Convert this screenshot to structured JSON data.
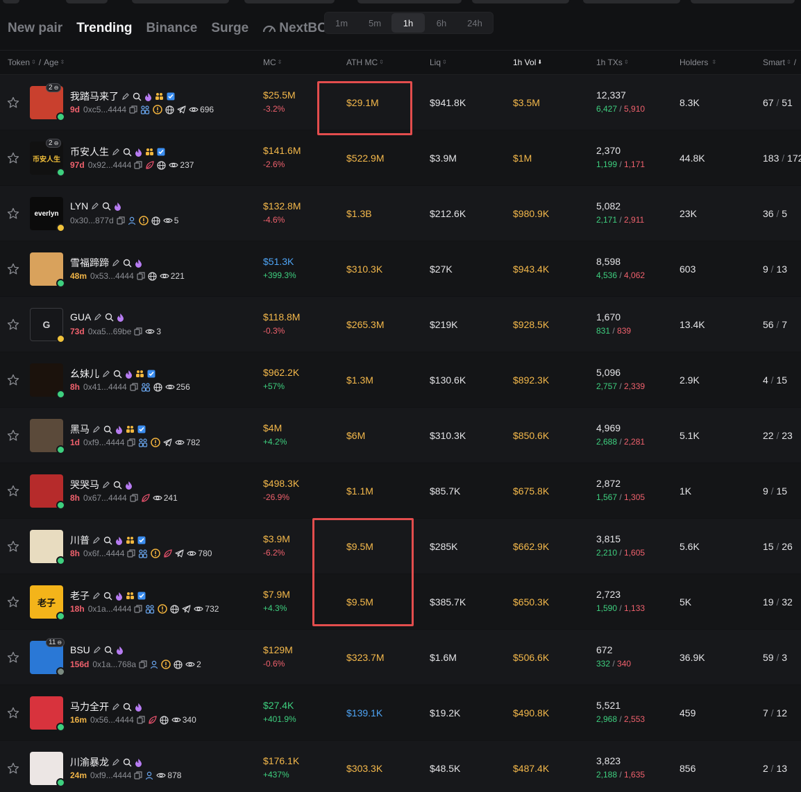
{
  "tabs": [
    {
      "label": "New pair",
      "active": false
    },
    {
      "label": "Trending",
      "active": true
    },
    {
      "label": "Binance",
      "active": false
    },
    {
      "label": "Surge",
      "active": false
    },
    {
      "label": "NextBC",
      "active": false,
      "icon": "gauge-icon"
    }
  ],
  "timeframes": [
    {
      "label": "1m",
      "active": false
    },
    {
      "label": "5m",
      "active": false
    },
    {
      "label": "1h",
      "active": true
    },
    {
      "label": "6h",
      "active": false
    },
    {
      "label": "24h",
      "active": false
    }
  ],
  "columns": {
    "token": "Token",
    "separator": "/",
    "age": "Age",
    "mc": "MC",
    "ath_mc": "ATH MC",
    "liq": "Liq",
    "vol": "1h Vol",
    "txs": "1h TXs",
    "holders": "Holders",
    "smart": "Smart",
    "smart_sep": "/"
  },
  "colors": {
    "background": "#111214",
    "row": "#17181b",
    "gold": "#f5b94b",
    "blue": "#4ea4f5",
    "green": "#3ed07f",
    "red": "#f0616d",
    "highlight": "#e34d4d"
  },
  "rows": [
    {
      "name": "我踏马来了",
      "age": "9d",
      "address": "0xc5...4444",
      "views": "696",
      "mc": "$25.5M",
      "change": "-3.2%",
      "ath": "$29.1M",
      "liq": "$941.8K",
      "vol": "$3.5M",
      "txs": "12,337",
      "buys": "6,427",
      "sells": "5,910",
      "holders": "8.3K",
      "smart": "67",
      "kol": "51",
      "holders_badge": "2",
      "avatar_text": "",
      "avatar_bg": "#c9402e"
    },
    {
      "name": "币安人生",
      "age": "97d",
      "address": "0x92...4444",
      "views": "237",
      "mc": "$141.6M",
      "change": "-2.6%",
      "ath": "$522.9M",
      "liq": "$3.9M",
      "vol": "$1M",
      "txs": "2,370",
      "buys": "1,199",
      "sells": "1,171",
      "holders": "44.8K",
      "smart": "183",
      "kol": "172",
      "holders_badge": "2",
      "avatar_text": "币安人生",
      "avatar_bg": "#111111"
    },
    {
      "name": "LYN",
      "age": "",
      "address": "0x30...877d",
      "views": "5",
      "mc": "$132.8M",
      "change": "-4.6%",
      "ath": "$1.3B",
      "liq": "$212.6K",
      "vol": "$980.9K",
      "txs": "5,082",
      "buys": "2,171",
      "sells": "2,911",
      "holders": "23K",
      "smart": "36",
      "kol": "5",
      "holders_badge": "",
      "avatar_text": "everlyn",
      "avatar_bg": "#0b0b0b"
    },
    {
      "name": "雪福蹄蹄",
      "age": "48m",
      "address": "0x53...4444",
      "views": "221",
      "mc": "$51.3K",
      "change": "+399.3%",
      "ath": "$310.3K",
      "liq": "$27K",
      "vol": "$943.4K",
      "txs": "8,598",
      "buys": "4,536",
      "sells": "4,062",
      "holders": "603",
      "smart": "9",
      "kol": "13",
      "holders_badge": "",
      "avatar_text": "",
      "avatar_bg": "#d9a25c"
    },
    {
      "name": "GUA",
      "age": "73d",
      "address": "0xa5...69be",
      "views": "3",
      "mc": "$118.8M",
      "change": "-0.3%",
      "ath": "$265.3M",
      "liq": "$219K",
      "vol": "$928.5K",
      "txs": "1,670",
      "buys": "831",
      "sells": "839",
      "holders": "13.4K",
      "smart": "56",
      "kol": "7",
      "holders_badge": "",
      "avatar_text": "G",
      "avatar_bg": "#16171a"
    },
    {
      "name": "幺妹儿",
      "age": "8h",
      "address": "0x41...4444",
      "views": "256",
      "mc": "$962.2K",
      "change": "+57%",
      "ath": "$1.3M",
      "liq": "$130.6K",
      "vol": "$892.3K",
      "txs": "5,096",
      "buys": "2,757",
      "sells": "2,339",
      "holders": "2.9K",
      "smart": "4",
      "kol": "15",
      "holders_badge": "",
      "avatar_text": "",
      "avatar_bg": "#1b120c"
    },
    {
      "name": "黑马",
      "age": "1d",
      "address": "0xf9...4444",
      "views": "782",
      "mc": "$4M",
      "change": "+4.2%",
      "ath": "$6M",
      "liq": "$310.3K",
      "vol": "$850.6K",
      "txs": "4,969",
      "buys": "2,688",
      "sells": "2,281",
      "holders": "5.1K",
      "smart": "22",
      "kol": "23",
      "holders_badge": "",
      "avatar_text": "",
      "avatar_bg": "#5b4a3a"
    },
    {
      "name": "哭哭马",
      "age": "8h",
      "address": "0x67...4444",
      "views": "241",
      "mc": "$498.3K",
      "change": "-26.9%",
      "ath": "$1.1M",
      "liq": "$85.7K",
      "vol": "$675.8K",
      "txs": "2,872",
      "buys": "1,567",
      "sells": "1,305",
      "holders": "1K",
      "smart": "9",
      "kol": "15",
      "holders_badge": "",
      "avatar_text": "",
      "avatar_bg": "#b62b2b"
    },
    {
      "name": "川普",
      "age": "8h",
      "address": "0x6f...4444",
      "views": "780",
      "mc": "$3.9M",
      "change": "-6.2%",
      "ath": "$9.5M",
      "liq": "$285K",
      "vol": "$662.9K",
      "txs": "3,815",
      "buys": "2,210",
      "sells": "1,605",
      "holders": "5.6K",
      "smart": "15",
      "kol": "26",
      "holders_badge": "",
      "avatar_text": "",
      "avatar_bg": "#e8dcc0"
    },
    {
      "name": "老子",
      "age": "18h",
      "address": "0x1a...4444",
      "views": "732",
      "mc": "$7.9M",
      "change": "+4.3%",
      "ath": "$9.5M",
      "liq": "$385.7K",
      "vol": "$650.3K",
      "txs": "2,723",
      "buys": "1,590",
      "sells": "1,133",
      "holders": "5K",
      "smart": "19",
      "kol": "32",
      "holders_badge": "",
      "avatar_text": "老子",
      "avatar_bg": "#f4b41a"
    },
    {
      "name": "BSU",
      "age": "156d",
      "address": "0x1a...768a",
      "views": "2",
      "mc": "$129M",
      "change": "-0.6%",
      "ath": "$323.7M",
      "liq": "$1.6M",
      "vol": "$506.6K",
      "txs": "672",
      "buys": "332",
      "sells": "340",
      "holders": "36.9K",
      "smart": "59",
      "kol": "3",
      "holders_badge": "11",
      "avatar_text": "",
      "avatar_bg": "#2a78d6"
    },
    {
      "name": "马力全开",
      "age": "16m",
      "address": "0x56...4444",
      "views": "340",
      "mc": "$27.4K",
      "change": "+401.9%",
      "ath": "$139.1K",
      "liq": "$19.2K",
      "vol": "$490.8K",
      "txs": "5,521",
      "buys": "2,968",
      "sells": "2,553",
      "holders": "459",
      "smart": "7",
      "kol": "12",
      "holders_badge": "",
      "avatar_text": "",
      "avatar_bg": "#d8333d"
    },
    {
      "name": "川渝暴龙",
      "age": "24m",
      "address": "0xf9...4444",
      "views": "878",
      "mc": "$176.1K",
      "change": "+437%",
      "ath": "$303.3K",
      "liq": "$48.5K",
      "vol": "$487.4K",
      "txs": "3,823",
      "buys": "2,188",
      "sells": "1,635",
      "holders": "856",
      "smart": "2",
      "kol": "13",
      "holders_badge": "",
      "avatar_text": "",
      "avatar_bg": "#ece6e4"
    }
  ]
}
